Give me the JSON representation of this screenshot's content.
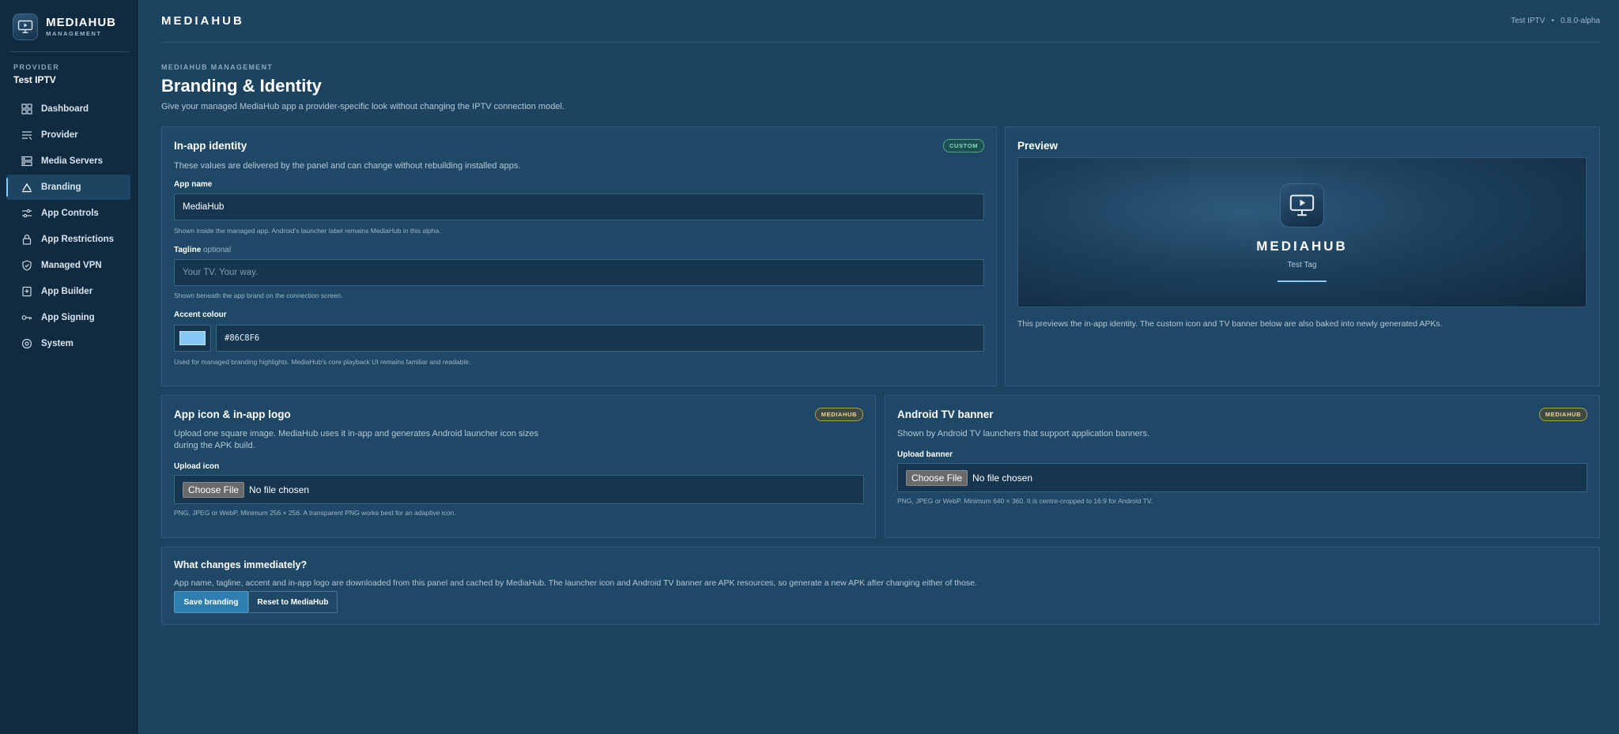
{
  "brand": {
    "name": "MEDIAHUB",
    "subtitle": "MANAGEMENT"
  },
  "provider": {
    "label": "PROVIDER",
    "name": "Test IPTV"
  },
  "nav": [
    {
      "label": "Dashboard",
      "icon": "grid-icon"
    },
    {
      "label": "Provider",
      "icon": "list-icon"
    },
    {
      "label": "Media Servers",
      "icon": "server-icon"
    },
    {
      "label": "Branding",
      "icon": "brush-icon",
      "active": true
    },
    {
      "label": "App Controls",
      "icon": "sliders-icon"
    },
    {
      "label": "App Restrictions",
      "icon": "lock-icon"
    },
    {
      "label": "Managed VPN",
      "icon": "shield-icon"
    },
    {
      "label": "App Builder",
      "icon": "package-icon"
    },
    {
      "label": "App Signing",
      "icon": "key-icon"
    },
    {
      "label": "System",
      "icon": "gear-icon"
    }
  ],
  "topbar": {
    "title": "MEDIAHUB",
    "provider": "Test IPTV",
    "separator": "•",
    "version": "0.8.0-alpha"
  },
  "page": {
    "eyebrow": "MEDIAHUB MANAGEMENT",
    "title": "Branding & Identity",
    "description": "Give your managed MediaHub app a provider-specific look without changing the IPTV connection model."
  },
  "identity": {
    "title": "In-app identity",
    "badge": "CUSTOM",
    "description": "These values are delivered by the panel and can change without rebuilding installed apps.",
    "app_name_label": "App name",
    "app_name_value": "MediaHub",
    "app_name_help": "Shown inside the managed app. Android's launcher label remains MediaHub in this alpha.",
    "tagline_label": "Tagline",
    "tagline_optional": "optional",
    "tagline_placeholder": "Your TV. Your way.",
    "tagline_help": "Shown beneath the app brand on the connection screen.",
    "accent_label": "Accent colour",
    "accent_value": "#86C8F6",
    "accent_help": "Used for managed branding highlights. MediaHub's core playback UI remains familiar and readable."
  },
  "preview": {
    "title": "Preview",
    "brand": "MEDIAHUB",
    "tagline": "Test Tag",
    "description": "This previews the in-app identity. The custom icon and TV banner below are also baked into newly generated APKs."
  },
  "app_icon": {
    "title": "App icon & in-app logo",
    "badge": "MEDIAHUB",
    "description_line1": "Upload one square image. MediaHub uses it in-app and generates Android launcher icon sizes",
    "description_line2": "during the APK build.",
    "upload_label": "Upload icon",
    "choose_label": "Choose File",
    "no_file": "No file chosen",
    "help": "PNG, JPEG or WebP. Minimum 256 × 256. A transparent PNG works best for an adaptive icon."
  },
  "tv_banner": {
    "title": "Android TV banner",
    "badge": "MEDIAHUB",
    "description": "Shown by Android TV launchers that support application banners.",
    "upload_label": "Upload banner",
    "choose_label": "Choose File",
    "no_file": "No file chosen",
    "help": "PNG, JPEG or WebP. Minimum 640 × 360. It is centre-cropped to 16:9 for Android TV."
  },
  "changes": {
    "title": "What changes immediately?",
    "description": "App name, tagline, accent and in-app logo are downloaded from this panel and cached by MediaHub. The launcher icon and Android TV banner are APK resources, so generate a new APK after changing either of those.",
    "save_label": "Save branding",
    "reset_label": "Reset to MediaHub"
  },
  "colors": {
    "accent": "#86C8F6",
    "background": "#1c4360",
    "sidebar": "#102a40",
    "card": "#1e4865"
  }
}
